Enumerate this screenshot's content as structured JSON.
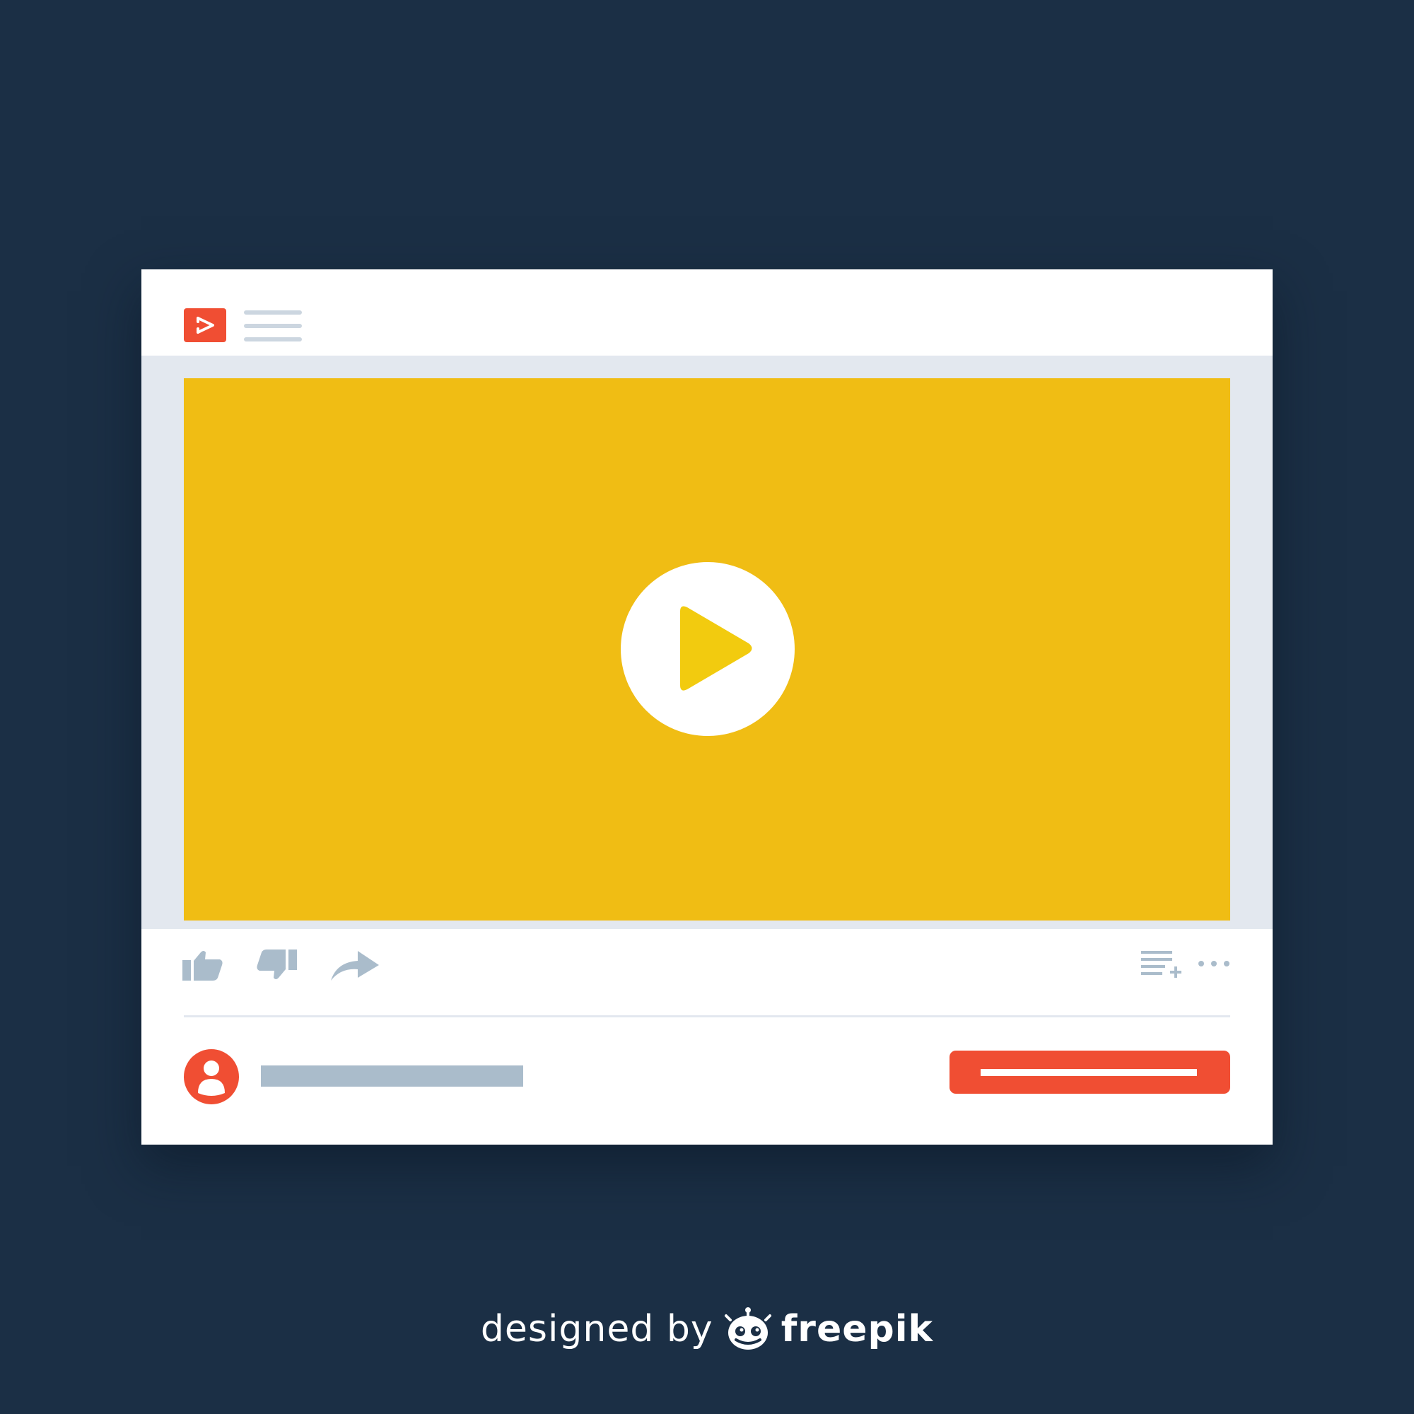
{
  "player": {
    "logo_icon": "video-play-logo-icon",
    "menu_icon": "hamburger-menu-icon",
    "play_icon": "play-icon",
    "actions": {
      "left": [
        "thumbs-up-icon",
        "thumbs-down-icon",
        "share-arrow-icon"
      ],
      "right": [
        "add-to-playlist-icon",
        "more-options-icon"
      ]
    },
    "avatar_icon": "user-avatar-icon"
  },
  "credit": {
    "prefix": "designed by",
    "brand": "freepik"
  },
  "colors": {
    "background": "#1b2f45",
    "window": "#ffffff",
    "video_border": "#e3e8ef",
    "video": "#f0bd14",
    "play_triangle": "#f2cb0f",
    "accent": "#f04e33",
    "icon_gray": "#aabccb"
  }
}
